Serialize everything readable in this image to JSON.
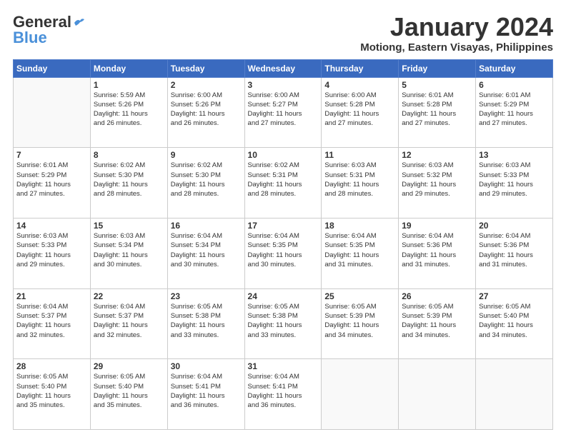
{
  "header": {
    "logo_general": "General",
    "logo_blue": "Blue",
    "month_title": "January 2024",
    "location": "Motiong, Eastern Visayas, Philippines"
  },
  "days_of_week": [
    "Sunday",
    "Monday",
    "Tuesday",
    "Wednesday",
    "Thursday",
    "Friday",
    "Saturday"
  ],
  "weeks": [
    [
      {
        "num": "",
        "info": ""
      },
      {
        "num": "1",
        "info": "Sunrise: 5:59 AM\nSunset: 5:26 PM\nDaylight: 11 hours\nand 26 minutes."
      },
      {
        "num": "2",
        "info": "Sunrise: 6:00 AM\nSunset: 5:26 PM\nDaylight: 11 hours\nand 26 minutes."
      },
      {
        "num": "3",
        "info": "Sunrise: 6:00 AM\nSunset: 5:27 PM\nDaylight: 11 hours\nand 27 minutes."
      },
      {
        "num": "4",
        "info": "Sunrise: 6:00 AM\nSunset: 5:28 PM\nDaylight: 11 hours\nand 27 minutes."
      },
      {
        "num": "5",
        "info": "Sunrise: 6:01 AM\nSunset: 5:28 PM\nDaylight: 11 hours\nand 27 minutes."
      },
      {
        "num": "6",
        "info": "Sunrise: 6:01 AM\nSunset: 5:29 PM\nDaylight: 11 hours\nand 27 minutes."
      }
    ],
    [
      {
        "num": "7",
        "info": "Sunrise: 6:01 AM\nSunset: 5:29 PM\nDaylight: 11 hours\nand 27 minutes."
      },
      {
        "num": "8",
        "info": "Sunrise: 6:02 AM\nSunset: 5:30 PM\nDaylight: 11 hours\nand 28 minutes."
      },
      {
        "num": "9",
        "info": "Sunrise: 6:02 AM\nSunset: 5:30 PM\nDaylight: 11 hours\nand 28 minutes."
      },
      {
        "num": "10",
        "info": "Sunrise: 6:02 AM\nSunset: 5:31 PM\nDaylight: 11 hours\nand 28 minutes."
      },
      {
        "num": "11",
        "info": "Sunrise: 6:03 AM\nSunset: 5:31 PM\nDaylight: 11 hours\nand 28 minutes."
      },
      {
        "num": "12",
        "info": "Sunrise: 6:03 AM\nSunset: 5:32 PM\nDaylight: 11 hours\nand 29 minutes."
      },
      {
        "num": "13",
        "info": "Sunrise: 6:03 AM\nSunset: 5:33 PM\nDaylight: 11 hours\nand 29 minutes."
      }
    ],
    [
      {
        "num": "14",
        "info": "Sunrise: 6:03 AM\nSunset: 5:33 PM\nDaylight: 11 hours\nand 29 minutes."
      },
      {
        "num": "15",
        "info": "Sunrise: 6:03 AM\nSunset: 5:34 PM\nDaylight: 11 hours\nand 30 minutes."
      },
      {
        "num": "16",
        "info": "Sunrise: 6:04 AM\nSunset: 5:34 PM\nDaylight: 11 hours\nand 30 minutes."
      },
      {
        "num": "17",
        "info": "Sunrise: 6:04 AM\nSunset: 5:35 PM\nDaylight: 11 hours\nand 30 minutes."
      },
      {
        "num": "18",
        "info": "Sunrise: 6:04 AM\nSunset: 5:35 PM\nDaylight: 11 hours\nand 31 minutes."
      },
      {
        "num": "19",
        "info": "Sunrise: 6:04 AM\nSunset: 5:36 PM\nDaylight: 11 hours\nand 31 minutes."
      },
      {
        "num": "20",
        "info": "Sunrise: 6:04 AM\nSunset: 5:36 PM\nDaylight: 11 hours\nand 31 minutes."
      }
    ],
    [
      {
        "num": "21",
        "info": "Sunrise: 6:04 AM\nSunset: 5:37 PM\nDaylight: 11 hours\nand 32 minutes."
      },
      {
        "num": "22",
        "info": "Sunrise: 6:04 AM\nSunset: 5:37 PM\nDaylight: 11 hours\nand 32 minutes."
      },
      {
        "num": "23",
        "info": "Sunrise: 6:05 AM\nSunset: 5:38 PM\nDaylight: 11 hours\nand 33 minutes."
      },
      {
        "num": "24",
        "info": "Sunrise: 6:05 AM\nSunset: 5:38 PM\nDaylight: 11 hours\nand 33 minutes."
      },
      {
        "num": "25",
        "info": "Sunrise: 6:05 AM\nSunset: 5:39 PM\nDaylight: 11 hours\nand 34 minutes."
      },
      {
        "num": "26",
        "info": "Sunrise: 6:05 AM\nSunset: 5:39 PM\nDaylight: 11 hours\nand 34 minutes."
      },
      {
        "num": "27",
        "info": "Sunrise: 6:05 AM\nSunset: 5:40 PM\nDaylight: 11 hours\nand 34 minutes."
      }
    ],
    [
      {
        "num": "28",
        "info": "Sunrise: 6:05 AM\nSunset: 5:40 PM\nDaylight: 11 hours\nand 35 minutes."
      },
      {
        "num": "29",
        "info": "Sunrise: 6:05 AM\nSunset: 5:40 PM\nDaylight: 11 hours\nand 35 minutes."
      },
      {
        "num": "30",
        "info": "Sunrise: 6:04 AM\nSunset: 5:41 PM\nDaylight: 11 hours\nand 36 minutes."
      },
      {
        "num": "31",
        "info": "Sunrise: 6:04 AM\nSunset: 5:41 PM\nDaylight: 11 hours\nand 36 minutes."
      },
      {
        "num": "",
        "info": ""
      },
      {
        "num": "",
        "info": ""
      },
      {
        "num": "",
        "info": ""
      }
    ]
  ]
}
